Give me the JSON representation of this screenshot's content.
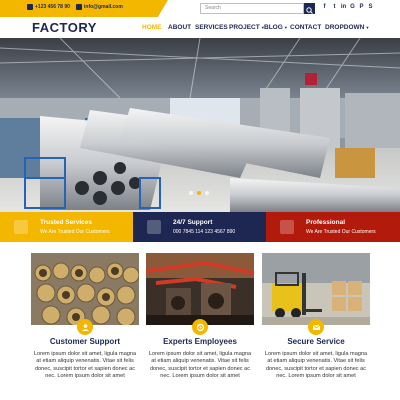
{
  "topbar": {
    "phone": "+123 456 78 90",
    "email": "info@gmail.com",
    "search_placeholder": "Search",
    "social": [
      "f",
      "t",
      "in",
      "G",
      "P",
      "S"
    ]
  },
  "nav": {
    "logo": "FACTORY",
    "items": [
      "HOME",
      "ABOUT",
      "SERVICES",
      "PROJECT",
      "BLOG",
      "CONTACT",
      "DROPDOWN"
    ],
    "active": "HOME"
  },
  "hero": {
    "slide_count": 3,
    "active_slide": 1
  },
  "features": [
    {
      "title": "Trusted Services",
      "subtitle": "We Are Trusted Our Customers"
    },
    {
      "title": "24/7 Support",
      "subtitle": "000 7845 114 123 4567 890"
    },
    {
      "title": "Professional",
      "subtitle": "We Are Trusted Our Customers"
    }
  ],
  "services": [
    {
      "title": "Customer Support",
      "text": "Lorem ipsum dolor sit amet, ligula magna at etiam aliquip venenatis. Vitae sit felis donec, suscipit tortor et sapien donec ac nec. Lorem ipsum dolor sit amet"
    },
    {
      "title": "Experts Employees",
      "text": "Lorem ipsum dolor sit amet, ligula magna at etiam aliquip venenatis. Vitae sit felis donec, suscipit tortor et sapien donec ac nec. Lorem ipsum dolor sit amet"
    },
    {
      "title": "Secure Service",
      "text": "Lorem ipsum dolor sit amet, ligula magna at etiam aliquip venenatis. Vitae sit felis donec, suscipit tortor et sapien donec ac nec. Lorem ipsum dolor sit amet"
    }
  ],
  "colors": {
    "brand_yellow": "#f3b700",
    "brand_navy": "#1d2752",
    "brand_red": "#b21a0c"
  }
}
